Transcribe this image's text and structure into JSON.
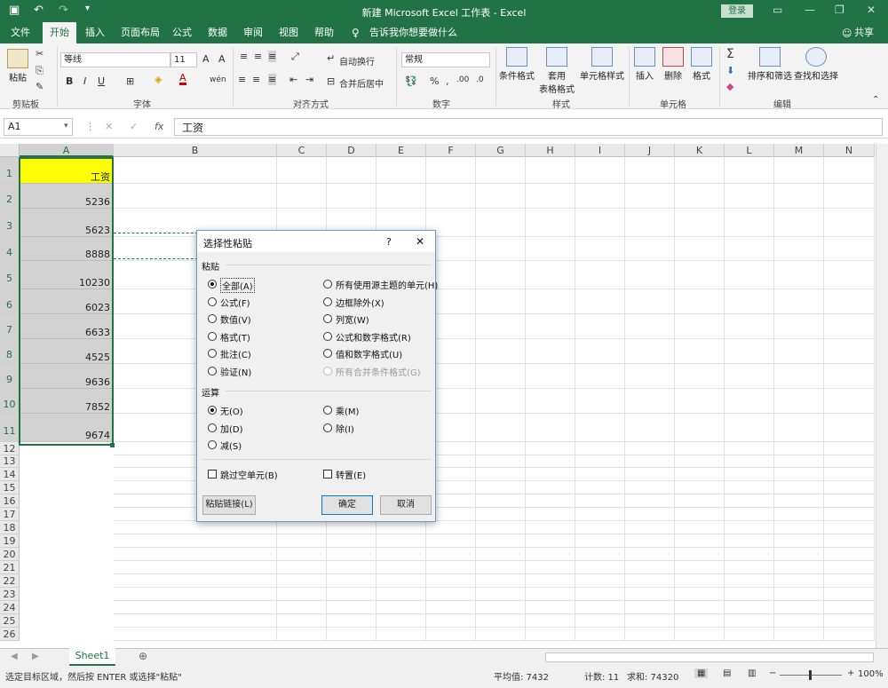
{
  "window": {
    "title": "新建 Microsoft Excel 工作表 - Excel",
    "login_label": "登录",
    "share_label": "共享"
  },
  "tabs": [
    "文件",
    "开始",
    "插入",
    "页面布局",
    "公式",
    "数据",
    "审阅",
    "视图",
    "帮助"
  ],
  "tell_me": "告诉我你想要做什么",
  "ribbon": {
    "paste": "粘贴",
    "font_name": "等线",
    "font_size": "11",
    "wrap_text": "自动换行",
    "merge_center": "合并后居中",
    "number_format": "常规",
    "cond_format": "条件格式",
    "table_format_1": "套用",
    "table_format_2": "表格格式",
    "cell_style": "单元格样式",
    "insert": "插入",
    "delete": "删除",
    "format": "格式",
    "sort_filter": "排序和筛选",
    "find_select": "查找和选择",
    "groups": {
      "clipboard": "剪贴板",
      "font": "字体",
      "alignment": "对齐方式",
      "number": "数字",
      "styles": "样式",
      "cells": "单元格",
      "editing": "编辑"
    }
  },
  "formula_bar": {
    "name_box": "A1",
    "fx": "fx",
    "content": "工资"
  },
  "columns": [
    "A",
    "B",
    "C",
    "D",
    "E",
    "F",
    "G",
    "H",
    "I",
    "J",
    "K",
    "L",
    "M",
    "N"
  ],
  "rows": [
    "1",
    "2",
    "3",
    "4",
    "5",
    "6",
    "7",
    "8",
    "9",
    "10",
    "11",
    "12",
    "13",
    "14",
    "15",
    "16",
    "17",
    "18",
    "19",
    "20",
    "21",
    "22",
    "23",
    "24",
    "25",
    "26"
  ],
  "cells_a": [
    "工资",
    "5236",
    "5623",
    "8888",
    "10230",
    "6023",
    "6633",
    "4525",
    "9636",
    "7852",
    "9674"
  ],
  "dialog": {
    "title": "选择性粘贴",
    "help": "?",
    "close": "✕",
    "paste_section": "粘贴",
    "paste_left": [
      "全部(A)",
      "公式(F)",
      "数值(V)",
      "格式(T)",
      "批注(C)",
      "验证(N)"
    ],
    "paste_right": [
      "所有使用源主题的单元(H)",
      "边框除外(X)",
      "列宽(W)",
      "公式和数字格式(R)",
      "值和数字格式(U)",
      "所有合并条件格式(G)"
    ],
    "op_section": "运算",
    "op_left": [
      "无(O)",
      "加(D)",
      "减(S)"
    ],
    "op_right": [
      "乘(M)",
      "除(I)"
    ],
    "skip_blanks": "跳过空单元(B)",
    "transpose": "转置(E)",
    "paste_link": "粘贴链接(L)",
    "ok": "确定",
    "cancel": "取消"
  },
  "sheet_tab": "Sheet1",
  "status": {
    "message": "选定目标区域，然后按 ENTER 或选择\"粘贴\"",
    "average": "平均值: 7432",
    "count": "计数: 11",
    "sum": "求和: 74320",
    "zoom": "100%"
  },
  "colors": {
    "excel_green": "#217346",
    "header_fill": "#ffff00",
    "selection": "#d2d2d2"
  }
}
